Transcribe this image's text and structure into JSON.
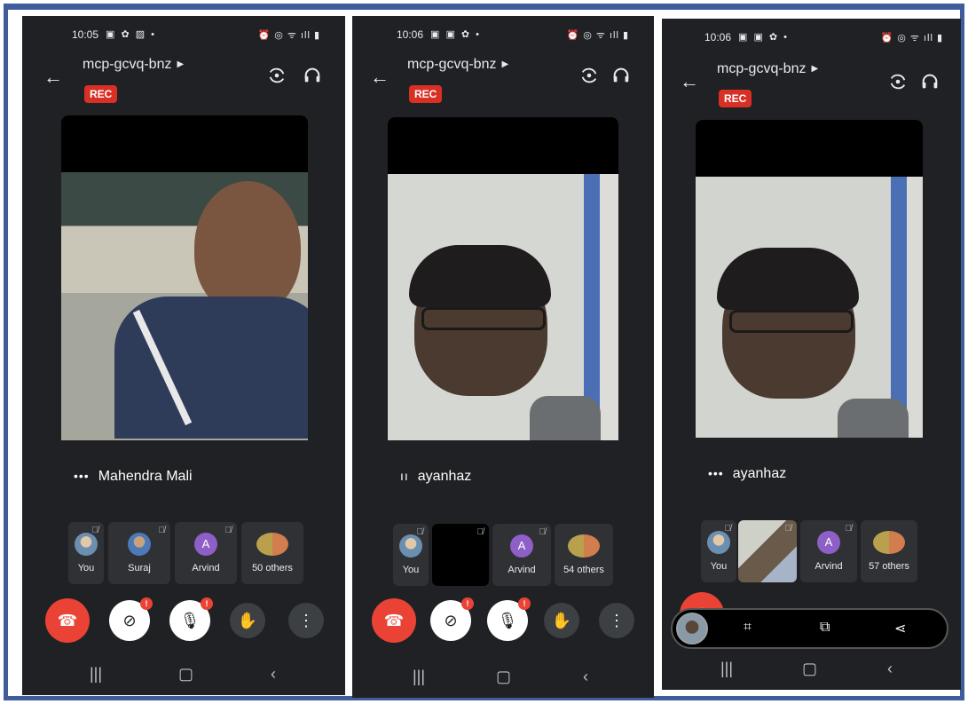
{
  "panels": [
    {
      "status_time": "10:05",
      "meeting_code": "mcp-gcvq-bnz",
      "rec_label": "REC",
      "speaker_name": "Mahendra Mali",
      "speaker_indicator": "•••",
      "participants": [
        {
          "label": "You",
          "avatar": "photo"
        },
        {
          "label": "Suraj",
          "avatar": "photo"
        },
        {
          "label": "Arvind",
          "avatar": "letter",
          "letter": "A"
        },
        {
          "label": "50 others",
          "avatar": "group"
        }
      ],
      "badge_count": "!"
    },
    {
      "status_time": "10:06",
      "meeting_code": "mcp-gcvq-bnz",
      "rec_label": "REC",
      "speaker_name": "ayanhaz",
      "speaker_indicator": "ıı",
      "participants": [
        {
          "label": "You",
          "avatar": "photo"
        },
        {
          "label": "",
          "avatar": "video-dark"
        },
        {
          "label": "Arvind",
          "avatar": "letter",
          "letter": "A"
        },
        {
          "label": "54 others",
          "avatar": "group"
        }
      ],
      "badge_count": "!"
    },
    {
      "status_time": "10:06",
      "meeting_code": "mcp-gcvq-bnz",
      "rec_label": "REC",
      "speaker_name": "ayanhaz",
      "speaker_indicator": "•••",
      "participants": [
        {
          "label": "You",
          "avatar": "photo"
        },
        {
          "label": "",
          "avatar": "video-light"
        },
        {
          "label": "Arvind",
          "avatar": "letter",
          "letter": "A"
        },
        {
          "label": "57 others",
          "avatar": "group"
        }
      ]
    }
  ],
  "icons": {
    "back": "arrow-left-icon",
    "camera_switch": "camera-switch-icon",
    "audio": "headset-icon",
    "end_call": "phone-hangup-icon",
    "camera_off": "video-off-icon",
    "mic_off": "mic-off-icon",
    "raise_hand": "hand-icon",
    "more": "more-vertical-icon"
  },
  "colors": {
    "rec": "#d93025",
    "end_call": "#ea4335",
    "frame_border": "#3f5d9c",
    "background": "#202124",
    "avatar_letter": "#8e5fc7"
  }
}
